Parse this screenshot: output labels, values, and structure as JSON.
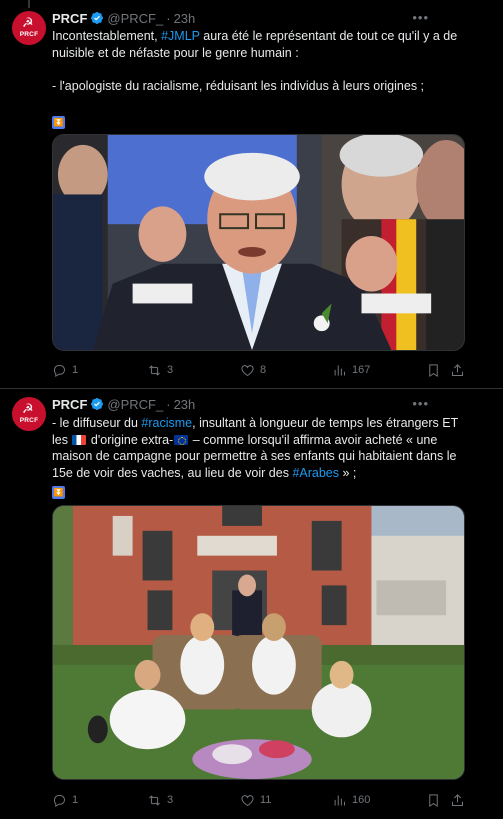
{
  "colors": {
    "background": "#000000",
    "text": "#e7e9ea",
    "muted": "#71767b",
    "link": "#1d9bf0",
    "avatar_bg": "#c8102e"
  },
  "tweets": [
    {
      "author": "PRCF",
      "avatar_text": "PRCF",
      "handle": "@PRCF_",
      "time": "23h",
      "body": {
        "p1_before": "Incontestablement, ",
        "p1_link": "#JMLP",
        "p1_after": " aura été le représentant de tout ce qu'il y a de nuisible et de néfaste pour le genre humain :",
        "p2": "- l'apologiste du racialisme, réduisant les individus à leurs origines ;",
        "emoji": "down-arrow-emoji"
      },
      "metrics": {
        "replies": "1",
        "retweets": "3",
        "likes": "8",
        "views": "167"
      }
    },
    {
      "author": "PRCF",
      "avatar_text": "PRCF",
      "handle": "@PRCF_",
      "time": "23h",
      "body": {
        "s1": "- le diffuseur du ",
        "link1": "#racisme",
        "s2": ", insultant à longueur de temps les étrangers ET les ",
        "s3": " d'origine extra-",
        "s4": " – comme lorsqu'il affirma avoir acheté « une maison de campagne pour permettre à ses enfants qui habitaient dans le 15e de voir des vaches, au lieu de voir des ",
        "link2": "#Arabes",
        "s5": " » ;",
        "emoji": "down-arrow-emoji"
      },
      "metrics": {
        "replies": "1",
        "retweets": "3",
        "likes": "11",
        "views": "160"
      }
    }
  ],
  "icons": [
    "verified-badge-icon",
    "more-icon",
    "reply-icon",
    "retweet-icon",
    "like-icon",
    "views-icon",
    "bookmark-icon",
    "share-icon"
  ]
}
